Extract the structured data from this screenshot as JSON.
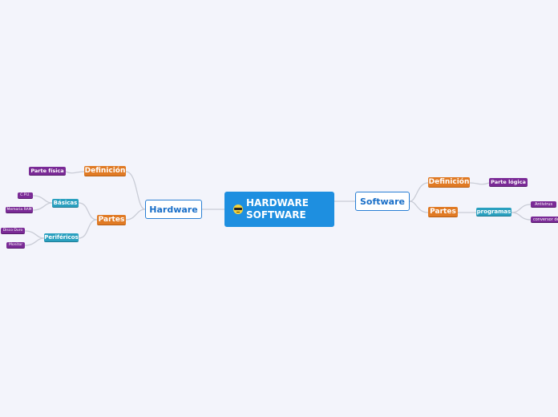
{
  "central": {
    "line1": "HARDWARE",
    "line2": "SOFTWARE",
    "icon": "sunglasses-emoji-icon"
  },
  "hardware": {
    "label": "Hardware",
    "definicion": {
      "label": "Definición",
      "child": "Parte física"
    },
    "partes": {
      "label": "Partes",
      "basicas": {
        "label": "Básicas",
        "children": [
          "C.P.U.",
          "Memoria RAM"
        ]
      },
      "perifericos": {
        "label": "Periféricos",
        "children": [
          "Disco Duro",
          "Monitor"
        ]
      }
    }
  },
  "software": {
    "label": "Software",
    "definicion": {
      "label": "Definición",
      "child": "Parte lógica"
    },
    "partes": {
      "label": "Partes",
      "programas": {
        "label": "programas",
        "children": [
          "Antivirus",
          "conversor de"
        ]
      }
    }
  },
  "colors": {
    "central": "#1e8fe0",
    "main_border": "#2a7fd4",
    "orange": "#e07a24",
    "teal": "#2aa0bf",
    "purple": "#7a2a96",
    "background": "#f3f4fb"
  }
}
